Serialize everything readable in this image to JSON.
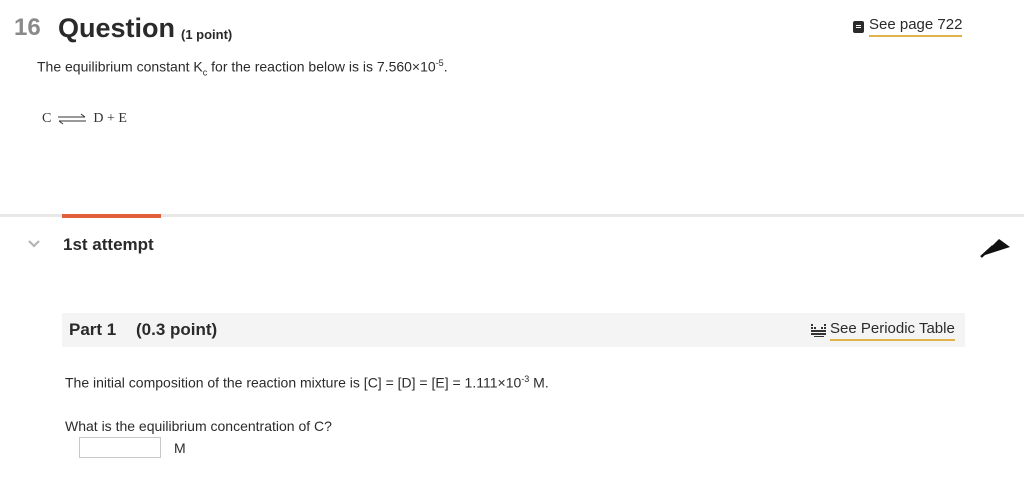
{
  "question": {
    "number": "16",
    "title": "Question",
    "points": "(1 point)",
    "see_page": "See page 722",
    "text_prefix": "The equilibrium constant K",
    "text_sub": "c",
    "text_middle": " for the reaction below is is 7.560×10",
    "text_sup": "-5",
    "text_suffix": ".",
    "reaction_left": "C",
    "reaction_right": "D + E"
  },
  "attempt": {
    "label": "1st attempt"
  },
  "part": {
    "title": "Part 1",
    "points": "(0.3 point)",
    "periodic_link": "See Periodic Table",
    "initial_prefix": "The initial composition of the reaction mixture is [C] = [D] = [E] = 1.111×10",
    "initial_sup": "-3",
    "initial_suffix": " M.",
    "ask": "What is the equilibrium concentration of C?",
    "answer_value": "",
    "unit": "M"
  },
  "colors": {
    "accent": "#e35f3b",
    "link_underline": "#e0b24a",
    "part_header_bg": "#f4f4f4"
  },
  "icons": [
    "book-icon",
    "equilibrium-arrow-icon",
    "chevron-down-icon",
    "pointer-cursor-icon",
    "periodic-table-icon"
  ]
}
